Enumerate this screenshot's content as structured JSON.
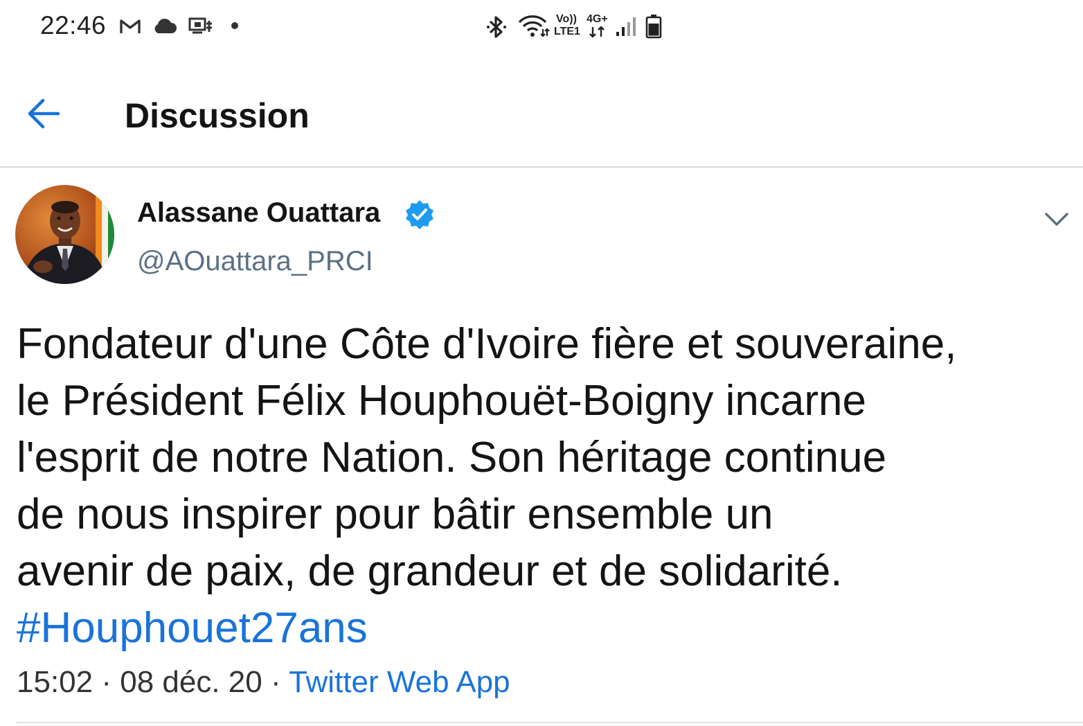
{
  "status_bar": {
    "time": "22:46",
    "network_label_top": "Vo))",
    "network_label_bottom": "LTE1",
    "network_type": "4G+",
    "left_icons": [
      "gmail-icon",
      "cloud-icon",
      "cast-icon",
      "dot-icon"
    ],
    "right_icons": [
      "bluetooth-icon",
      "wifi-icon",
      "signal-icon",
      "battery-icon"
    ]
  },
  "app_bar": {
    "title": "Discussion",
    "back_icon": "arrow-left-icon"
  },
  "tweet": {
    "author_name": "Alassane Ouattara",
    "author_handle": "@AOuattara_PRCI",
    "verified": true,
    "text_lines": [
      "Fondateur d'une Côte d'Ivoire fière et souveraine,",
      "le Président Félix Houphouët-Boigny incarne",
      "l'esprit de notre Nation. Son héritage continue",
      "de nous inspirer pour bâtir ensemble un",
      "avenir de paix, de grandeur et de solidarité."
    ],
    "hashtag": "#Houphouet27ans",
    "time": "15:02",
    "separator": "·",
    "date": "08 déc. 20",
    "source": "Twitter Web App"
  },
  "colors": {
    "accent": "#1a73d9",
    "verified": "#1d9bf0",
    "handle": "#5b7083",
    "text": "#141414"
  }
}
